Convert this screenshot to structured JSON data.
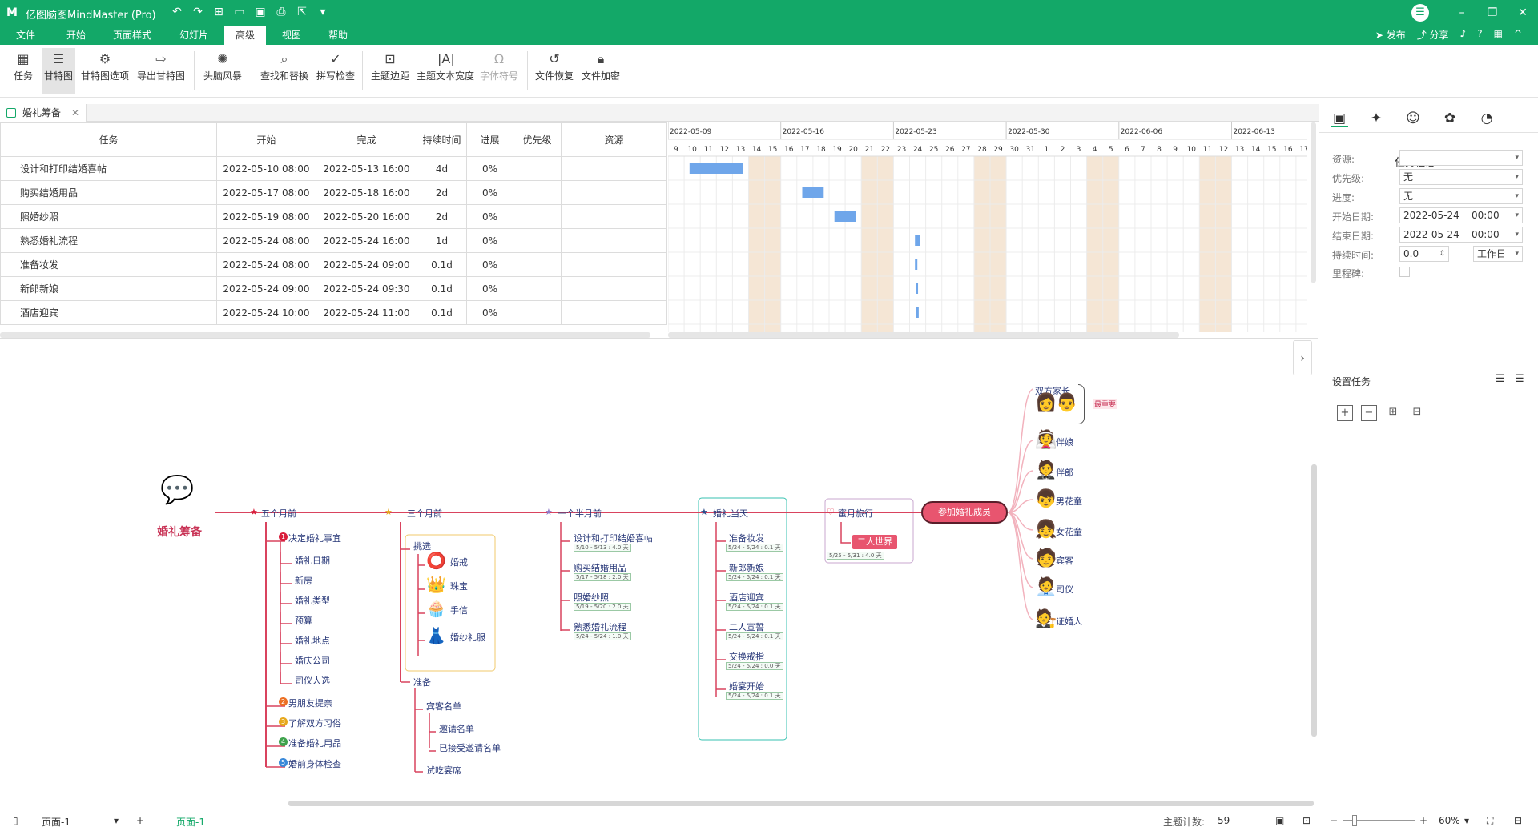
{
  "app": {
    "title": "亿图脑图MindMaster (Pro)",
    "brand_color": "#13a868"
  },
  "menu_tabs": [
    "文件",
    "开始",
    "页面样式",
    "幻灯片",
    "高级",
    "视图",
    "帮助"
  ],
  "menu_active": "高级",
  "menu_right": {
    "publish": "发布",
    "share": "分享"
  },
  "ribbon": [
    {
      "label": "任务",
      "icon": "task-icon",
      "active": false
    },
    {
      "label": "甘特图",
      "icon": "gantt-icon",
      "active": true
    },
    {
      "label": "甘特图选项",
      "icon": "gantt-options-icon",
      "active": false
    },
    {
      "label": "导出甘特图",
      "icon": "export-gantt-icon",
      "active": false
    },
    {
      "label": "头脑风暴",
      "icon": "brainstorm-icon",
      "active": false
    },
    {
      "label": "查找和替换",
      "icon": "find-replace-icon",
      "active": false
    },
    {
      "label": "拼写检查",
      "icon": "spell-check-icon",
      "active": false
    },
    {
      "label": "主题边距",
      "icon": "topic-margin-icon",
      "active": false
    },
    {
      "label": "主题文本宽度",
      "icon": "text-width-icon",
      "active": false
    },
    {
      "label": "字体符号",
      "icon": "omega-icon",
      "active": false,
      "disabled": true
    },
    {
      "label": "文件恢复",
      "icon": "file-recover-icon",
      "active": false
    },
    {
      "label": "文件加密",
      "icon": "file-lock-icon",
      "active": false
    }
  ],
  "doc_tab": "婚礼筹备",
  "gantt": {
    "columns": [
      "任务",
      "开始",
      "完成",
      "持续时间",
      "进展",
      "优先级",
      "资源"
    ],
    "rows": [
      {
        "task": "设计和打印结婚喜帖",
        "start": "2022-05-10 08:00",
        "end": "2022-05-13 16:00",
        "dur": "4d",
        "prog": "0%"
      },
      {
        "task": "购买结婚用品",
        "start": "2022-05-17 08:00",
        "end": "2022-05-18 16:00",
        "dur": "2d",
        "prog": "0%"
      },
      {
        "task": "照婚纱照",
        "start": "2022-05-19 08:00",
        "end": "2022-05-20 16:00",
        "dur": "2d",
        "prog": "0%"
      },
      {
        "task": "熟悉婚礼流程",
        "start": "2022-05-24 08:00",
        "end": "2022-05-24 16:00",
        "dur": "1d",
        "prog": "0%"
      },
      {
        "task": "准备妆发",
        "start": "2022-05-24 08:00",
        "end": "2022-05-24 09:00",
        "dur": "0.1d",
        "prog": "0%"
      },
      {
        "task": "新郎新娘",
        "start": "2022-05-24 09:00",
        "end": "2022-05-24 09:30",
        "dur": "0.1d",
        "prog": "0%"
      },
      {
        "task": "酒店迎宾",
        "start": "2022-05-24 10:00",
        "end": "2022-05-24 11:00",
        "dur": "0.1d",
        "prog": "0%"
      }
    ],
    "weeks": [
      "2022-05-09",
      "2022-05-16",
      "2022-05-23",
      "2022-05-30",
      "2022-06-06",
      "2022-06-13"
    ],
    "days": [
      "9",
      "10",
      "11",
      "12",
      "13",
      "14",
      "15",
      "16",
      "17",
      "18",
      "19",
      "20",
      "21",
      "22",
      "23",
      "24",
      "25",
      "26",
      "27",
      "28",
      "29",
      "30",
      "31",
      "1",
      "2",
      "3",
      "4",
      "5",
      "6",
      "7",
      "8",
      "9",
      "10",
      "11",
      "12",
      "13",
      "14",
      "15",
      "16",
      "17"
    ],
    "bar_color": "#6fa6ea",
    "weekend_color": "#f5e6d5"
  },
  "mindmap": {
    "root": "婚礼筹备",
    "branches": [
      "五个月前",
      "三个月前",
      "一个半月前",
      "婚礼当天",
      "蜜月旅行"
    ],
    "five": [
      "决定婚礼事宜",
      "婚礼日期",
      "新房",
      "婚礼类型",
      "预算",
      "婚礼地点",
      "婚庆公司",
      "司仪人选",
      "男朋友提亲",
      "了解双方习俗",
      "准备婚礼用品",
      "婚前身体检查"
    ],
    "three": [
      "挑选",
      "婚戒",
      "珠宝",
      "手信",
      "婚纱礼服",
      "准备",
      "宾客名单",
      "邀请名单",
      "已接受邀请名单",
      "试吃宴席"
    ],
    "onehalf": [
      "设计和打印结婚喜帖",
      "购买结婚用品",
      "照婚纱照",
      "熟悉婚礼流程"
    ],
    "onehalf_tags": [
      "5/10 - 5/13 : 4.0 天",
      "5/17 - 5/18 : 2.0 天",
      "5/19 - 5/20 : 2.0 天",
      "5/24 - 5/24 : 1.0 天"
    ],
    "day": [
      "准备妆发",
      "新郎新娘",
      "酒店迎宾",
      "二人宣誓",
      "交换戒指",
      "婚宴开始"
    ],
    "day_tags": [
      "5/24 - 5/24 : 0.1 天",
      "5/24 - 5/24 : 0.1 天",
      "5/24 - 5/24 : 0.1 天",
      "5/24 - 5/24 : 0.1 天",
      "5/24 - 5/24 : 0.0 天",
      "5/24 - 5/24 : 0.1 天"
    ],
    "honeymoon_child": "二人世界",
    "honeymoon_tag": "5/25 - 5/31 : 4.0 天",
    "members_title": "参加婚礼成员",
    "members": [
      "双方家长",
      "伴娘",
      "伴郎",
      "男花童",
      "女花童",
      "宾客",
      "司仪",
      "证婚人"
    ],
    "callout": "最重要"
  },
  "panel": {
    "title": "任务信息",
    "fields": [
      {
        "label": "资源:",
        "value": ""
      },
      {
        "label": "优先级:",
        "value": "无"
      },
      {
        "label": "进度:",
        "value": "无"
      },
      {
        "label": "开始日期:",
        "value": "2022-05-24    00:00"
      },
      {
        "label": "结束日期:",
        "value": "2022-05-24    00:00"
      }
    ],
    "duration_label": "持续时间:",
    "duration_value": "0.0",
    "duration_unit": "工作日",
    "milestone_label": "里程碑:",
    "set_task": "设置任务"
  },
  "status": {
    "page_select": "页面-1",
    "page_tab": "页面-1",
    "topic_count_label": "主题计数:",
    "topic_count": "59",
    "zoom": "60%"
  }
}
